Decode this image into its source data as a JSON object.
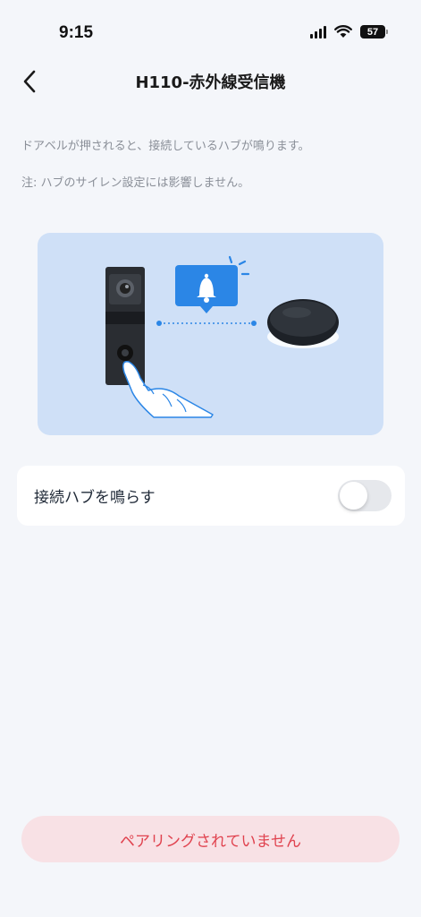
{
  "status_bar": {
    "time": "9:15",
    "battery": "57",
    "icons": [
      "signal-icon",
      "wifi-icon",
      "battery-icon"
    ]
  },
  "nav": {
    "title": "H110-赤外線受信機",
    "back_icon": "chevron-left-icon"
  },
  "description": "ドアベルが押されると、接続しているハブが鳴ります。",
  "note": "注: ハブのサイレン設定には影響しません。",
  "illustration": {
    "elements": [
      "doorbell",
      "bell-notification-icon",
      "hub-device",
      "finger-hand"
    ],
    "background_color": "#cfe0f7",
    "accent_color": "#2b86e6"
  },
  "toggle": {
    "label": "接続ハブを鳴らす",
    "checked": false
  },
  "pair_button": {
    "label": "ペアリングされていません",
    "text_color": "#e0424e",
    "background_color": "#f8e1e5"
  }
}
